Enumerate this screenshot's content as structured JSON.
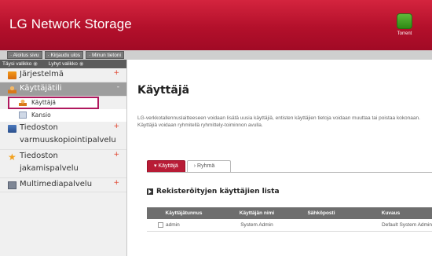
{
  "header": {
    "title": "LG Network Storage",
    "torrent_label": "Torrent",
    "colors": {
      "brand": "#b3102b",
      "torrent": "#2f8a14"
    }
  },
  "toplinks": [
    {
      "label": "· Aloitus sivu"
    },
    {
      "label": "· Kirjaudu ulos"
    },
    {
      "label": "· Minun tietoni"
    }
  ],
  "sidebar": {
    "toggles": [
      {
        "label": "Täysi valikko"
      },
      {
        "label": "Lyhyt valikko"
      }
    ],
    "items": [
      {
        "label": "Järjestelmä",
        "icon": "system-icon",
        "plus": "+"
      },
      {
        "label": "Käyttäjätili",
        "icon": "user-icon",
        "plus": "-",
        "active": true
      },
      {
        "label": "Tiedoston varmuuskopiointipalvelu",
        "icon": "backup-icon",
        "plus": "+"
      },
      {
        "label": "Tiedoston jakamispalvelu",
        "icon": "star-icon",
        "plus": "+"
      },
      {
        "label": "Multimediapalvelu",
        "icon": "media-icon",
        "plus": "+"
      }
    ],
    "subitems": [
      {
        "label": "Käyttäjä",
        "icon": "user-icon",
        "selected": true
      },
      {
        "label": "Kansio",
        "icon": "folder-icon"
      }
    ]
  },
  "main": {
    "title": "Käyttäjä",
    "description": "LG-verkkotallennuslaitteeseen voidaan lisätä uusia käyttäjiä, entisten käyttäjien tietoja voidaan muuttaa tai poistaa kokonaan. Käyttäjiä voidaan ryhmitellä ryhmittely-toiminnon avulla.",
    "tabs": [
      {
        "label": "▾ Käyttäjä",
        "active": true
      },
      {
        "label": "› Ryhmä",
        "active": false
      }
    ],
    "section_title": "Rekisteröityjen käyttäjien lista",
    "table": {
      "headers": [
        "Käyttäjätunnus",
        "Käyttäjän nimi",
        "Sähköposti",
        "Kuvaus"
      ],
      "rows": [
        [
          "admin",
          "System Admin",
          "",
          "Default System Admin"
        ]
      ]
    }
  }
}
